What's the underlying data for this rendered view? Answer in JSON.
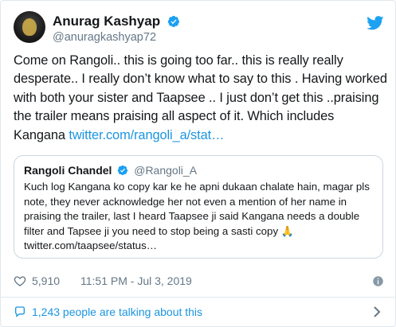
{
  "author": {
    "display_name": "Anurag Kashyap",
    "handle": "@anuragkashyap72"
  },
  "tweet": {
    "text": "Come on Rangoli.. this is going too far.. this is really really desperate.. I really don’t know what to say to this . Having worked with both your sister and Taapsee .. I just don’t get this ..praising the trailer means praising all aspect of it. Which includes Kangana ",
    "link": "twitter.com/rangoli_a/stat…"
  },
  "quoted": {
    "display_name": "Rangoli Chandel",
    "handle": "@Rangoli_A",
    "text": "Kuch log Kangana ko copy kar ke he apni dukaan chalate hain, magar pls note, they never acknowledge her not even a mention of her name in praising the trailer, last I heard Taapsee ji said Kangana needs a double filter and Tapsee ji you need to stop being a sasti copy ",
    "emoji": "🙏",
    "link": "twitter.com/taapsee/status…"
  },
  "meta": {
    "likes": "5,910",
    "timestamp": "11:51 PM - Jul 3, 2019"
  },
  "footer": {
    "talking": "1,243 people are talking about this"
  },
  "colors": {
    "link": "#1b95e0",
    "verified": "#1da1f2",
    "secondary_text": "#657786",
    "border": "#e1e8ed"
  },
  "icons": [
    "verified-badge-icon",
    "twitter-bird-icon",
    "heart-icon",
    "info-icon",
    "speech-bubble-icon",
    "chevron-right-icon",
    "folded-hands-emoji"
  ]
}
